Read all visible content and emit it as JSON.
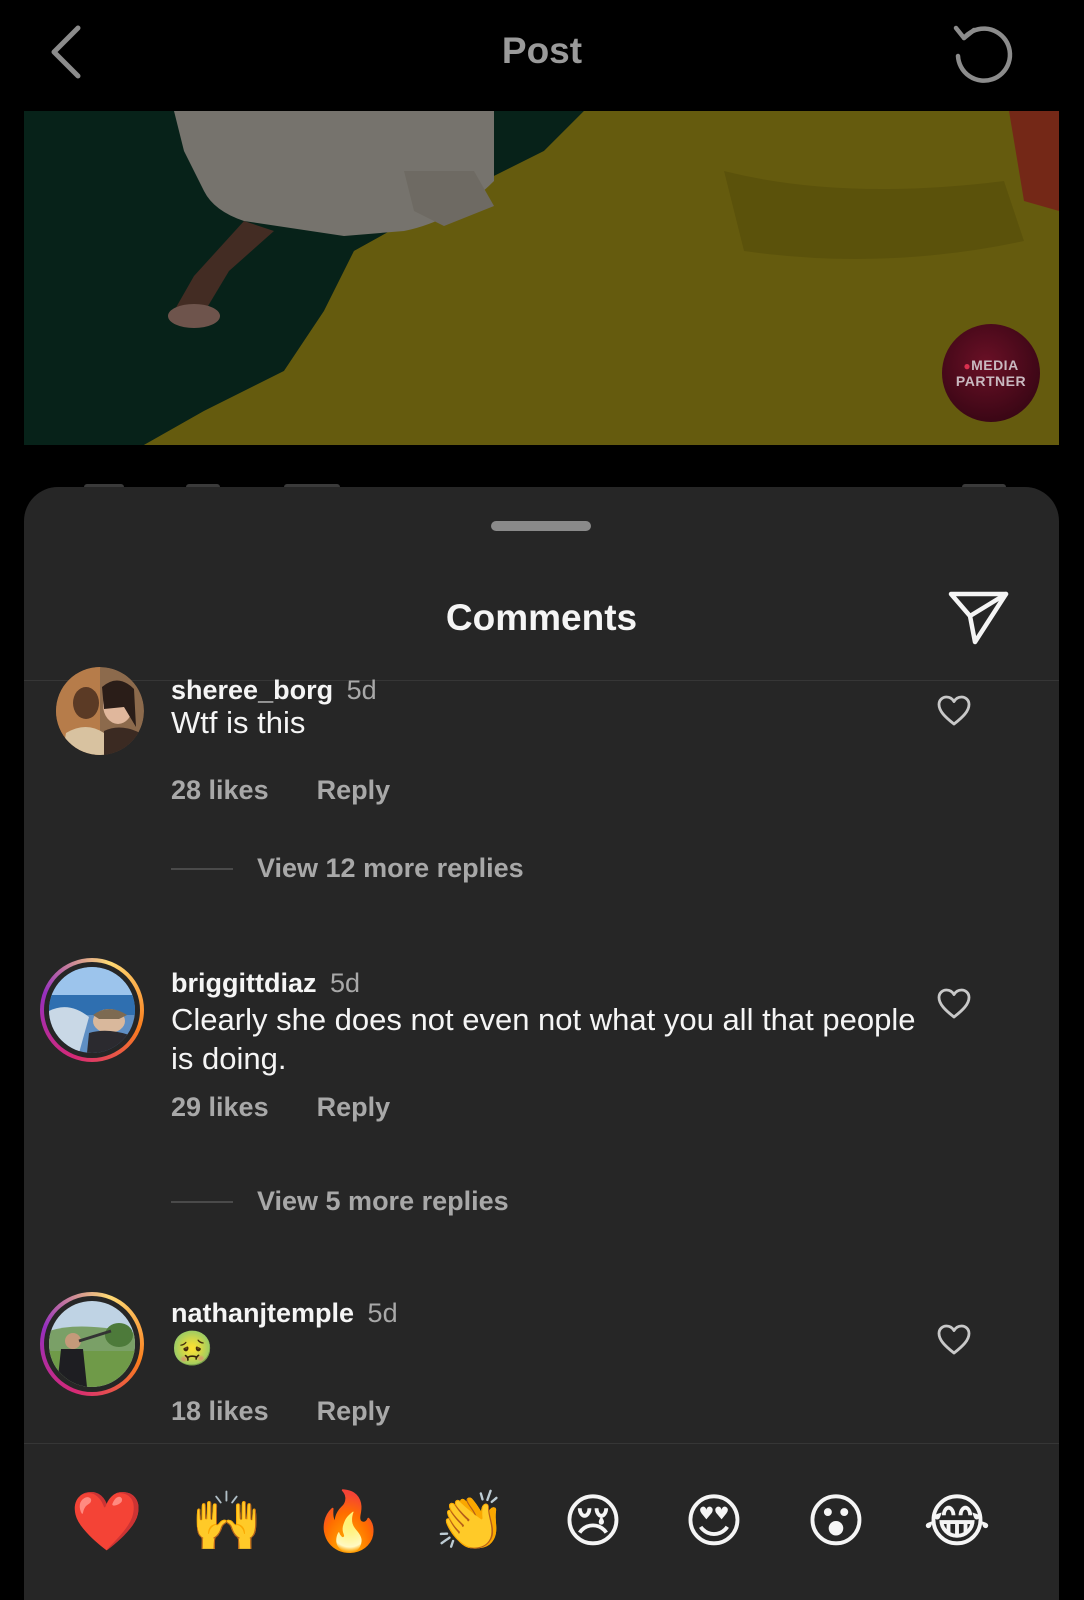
{
  "header": {
    "title": "Post",
    "back_icon": "chevron-left-icon",
    "refresh_icon": "refresh-icon"
  },
  "media": {
    "badge_line1": "MEDIA",
    "badge_line2": "PARTNER"
  },
  "sheet": {
    "title": "Comments",
    "share_icon": "send-icon"
  },
  "comments": [
    {
      "username": "sheree_borg",
      "time": "5d",
      "text": "Wtf is this",
      "likes": "28 likes",
      "reply": "Reply",
      "view_replies": "View 12 more replies"
    },
    {
      "username": "briggittdiaz",
      "time": "5d",
      "text": "Clearly she does not even not what you all that people is doing.",
      "likes": "29 likes",
      "reply": "Reply",
      "view_replies": "View 5 more replies"
    },
    {
      "username": "nathanjtemple",
      "time": "5d",
      "text": "🤢",
      "likes": "18 likes",
      "reply": "Reply"
    }
  ],
  "emoji_bar": [
    "❤️",
    "🙌",
    "🔥",
    "👏",
    "😢",
    "😍",
    "😮",
    "😂"
  ],
  "colors": {
    "background": "#000000",
    "sheet": "#262626",
    "text_primary": "#f5f5f5",
    "text_secondary": "#a8a8a8"
  }
}
